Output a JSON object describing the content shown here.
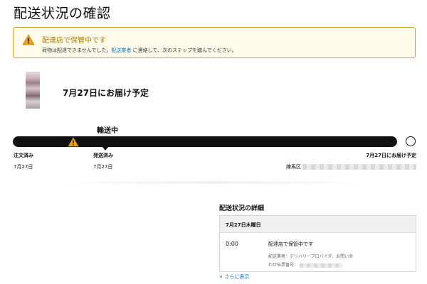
{
  "page": {
    "title": "配送状況の確認"
  },
  "alert": {
    "title": "配達店で保管中です",
    "body_before": "荷物は配達できませんでした。",
    "carrier_link": "配送業者",
    "body_after": " に連絡して、次のステップを踏んでください。",
    "border_color": "#c8a32e",
    "background_color": "#fffbea",
    "icon": "warning-icon"
  },
  "shipment": {
    "delivery_estimate": "7月27日にお届け予定"
  },
  "progress": {
    "current_label": "輸送中",
    "steps": [
      {
        "name": "注文済み",
        "date": "7月27日"
      },
      {
        "name": "発送済み",
        "date": "7月27日"
      },
      {
        "name": "7月27日にお届け予定",
        "date": "練馬区"
      }
    ]
  },
  "details": {
    "heading": "配送状況の詳細",
    "day": "7月27日木曜日",
    "event": {
      "time": "0:00",
      "status": "配達店で保管中です",
      "carrier_line": "配送業者：デリバリープロバイダ、お問い合",
      "tracking_line": "わせ伝票番号："
    },
    "show_more": "∨ さらに表示"
  }
}
